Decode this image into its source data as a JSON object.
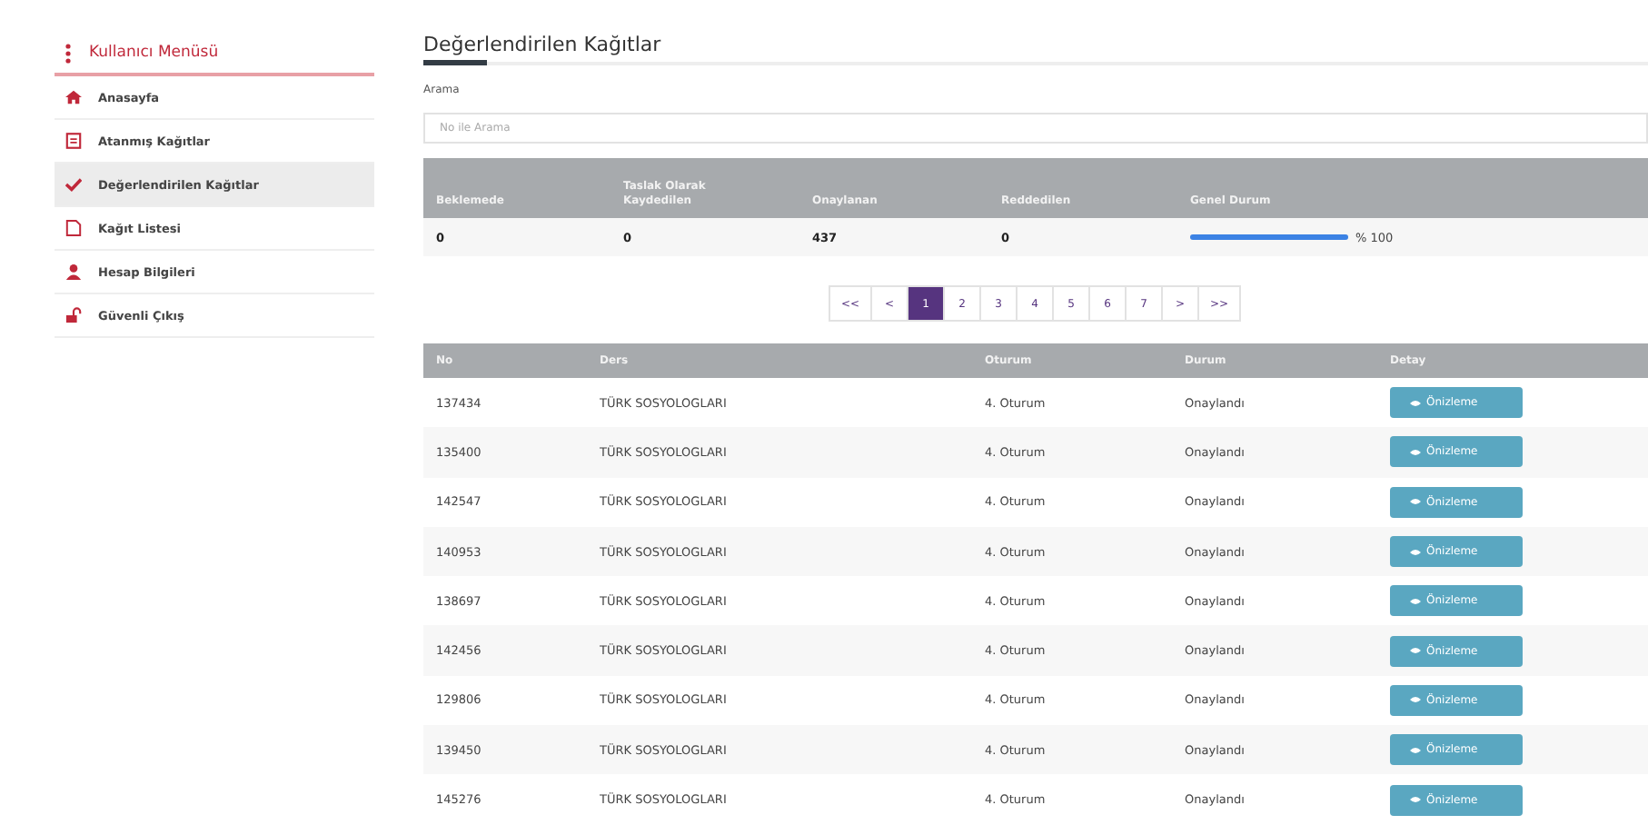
{
  "sidebar": {
    "title": "Kullanıcı Menüsü",
    "items": [
      {
        "label": "Anasayfa",
        "kind": "home",
        "selected": false
      },
      {
        "label": "Atanmış Kağıtlar",
        "kind": "doc",
        "selected": false
      },
      {
        "label": "Değerlendirilen Kağıtlar",
        "kind": "check",
        "selected": true
      },
      {
        "label": "Kağıt Listesi",
        "kind": "page",
        "selected": false
      },
      {
        "label": "Hesap Bilgileri",
        "kind": "user",
        "selected": false
      },
      {
        "label": "Güvenli Çıkış",
        "kind": "lock",
        "selected": false
      }
    ]
  },
  "page_title": "Değerlendirilen Kağıtlar",
  "search": {
    "label": "Arama",
    "placeholder": "No ile Arama"
  },
  "summary": {
    "columns": [
      "Beklemede",
      "Taslak Olarak Kaydedilen",
      "Onaylanan",
      "Reddedilen",
      "Genel Durum"
    ],
    "values": [
      "0",
      "0",
      "437",
      "0"
    ],
    "progress": {
      "level": 1,
      "reading": "% 100"
    }
  },
  "pagination": [
    {
      "label": "<<",
      "selected": false
    },
    {
      "label": "<",
      "selected": false
    },
    {
      "label": "1",
      "selected": true
    },
    {
      "label": "2",
      "selected": false
    },
    {
      "label": "3",
      "selected": false
    },
    {
      "label": "4",
      "selected": false
    },
    {
      "label": "5",
      "selected": false
    },
    {
      "label": "6",
      "selected": false
    },
    {
      "label": "7",
      "selected": false
    },
    {
      "label": ">",
      "selected": false
    },
    {
      "label": ">>",
      "selected": false
    }
  ],
  "table": {
    "columns": [
      "No",
      "Ders",
      "Oturum",
      "Durum",
      "Detay"
    ],
    "rows": [
      {
        "no": "137434",
        "ders": "TÜRK SOSYOLOGLARI",
        "oturum": "4. Oturum",
        "durum": "Onaylandı",
        "button": "Önizleme"
      },
      {
        "no": "135400",
        "ders": "TÜRK SOSYOLOGLARI",
        "oturum": "4. Oturum",
        "durum": "Onaylandı",
        "button": "Önizleme"
      },
      {
        "no": "142547",
        "ders": "TÜRK SOSYOLOGLARI",
        "oturum": "4. Oturum",
        "durum": "Onaylandı",
        "button": "Önizleme"
      },
      {
        "no": "140953",
        "ders": "TÜRK SOSYOLOGLARI",
        "oturum": "4. Oturum",
        "durum": "Onaylandı",
        "button": "Önizleme"
      },
      {
        "no": "138697",
        "ders": "TÜRK SOSYOLOGLARI",
        "oturum": "4. Oturum",
        "durum": "Onaylandı",
        "button": "Önizleme"
      },
      {
        "no": "142456",
        "ders": "TÜRK SOSYOLOGLARI",
        "oturum": "4. Oturum",
        "durum": "Onaylandı",
        "button": "Önizleme"
      },
      {
        "no": "129806",
        "ders": "TÜRK SOSYOLOGLARI",
        "oturum": "4. Oturum",
        "durum": "Onaylandı",
        "button": "Önizleme"
      },
      {
        "no": "139450",
        "ders": "TÜRK SOSYOLOGLARI",
        "oturum": "4. Oturum",
        "durum": "Onaylandı",
        "button": "Önizleme"
      },
      {
        "no": "145276",
        "ders": "TÜRK SOSYOLOGLARI",
        "oturum": "4. Oturum",
        "durum": "Onaylandı",
        "button": "Önizleme"
      }
    ]
  }
}
